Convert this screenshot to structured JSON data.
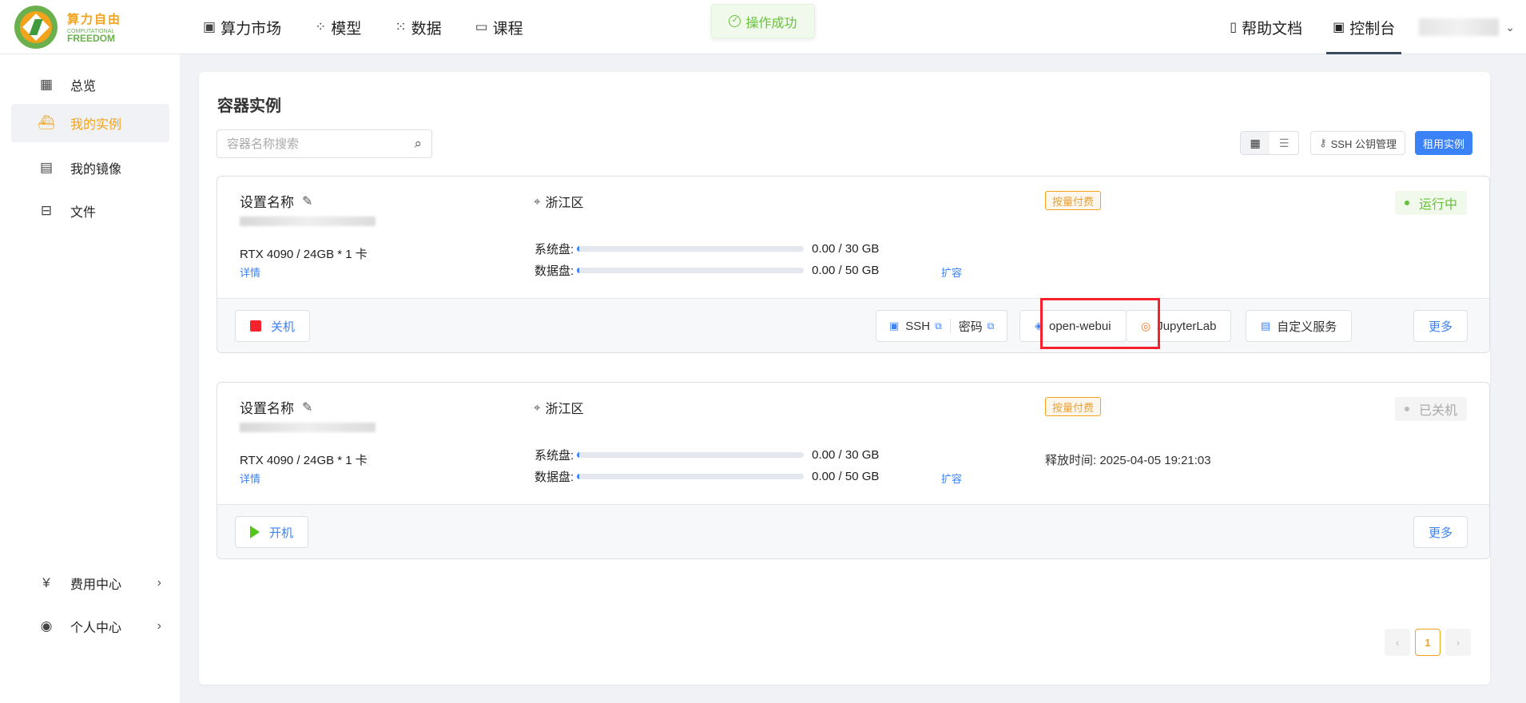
{
  "brand": {
    "cn": "算力自由",
    "en1": "COMPUTATIONAL",
    "en2": "FREEDOM"
  },
  "nav": [
    {
      "label": "算力市场",
      "icon": "chip-icon"
    },
    {
      "label": "模型",
      "icon": "model-icon"
    },
    {
      "label": "数据",
      "icon": "data-icon"
    },
    {
      "label": "课程",
      "icon": "course-icon"
    }
  ],
  "toast": {
    "text": "操作成功"
  },
  "right_nav": {
    "help": "帮助文档",
    "console": "控制台"
  },
  "sidebar": {
    "items": [
      {
        "label": "总览"
      },
      {
        "label": "我的实例"
      },
      {
        "label": "我的镜像"
      },
      {
        "label": "文件"
      }
    ],
    "bottom": [
      {
        "label": "费用中心"
      },
      {
        "label": "个人中心"
      }
    ]
  },
  "main": {
    "title": "容器实例",
    "search_placeholder": "容器名称搜索",
    "ssh_key_btn": "SSH 公钥管理",
    "rent_btn": "租用实例"
  },
  "instances": [
    {
      "name": "设置名称",
      "gpu": "RTX 4090 / 24GB  *  1 卡",
      "detail": "详情",
      "region": "浙江区",
      "billing": "按量付费",
      "status": "运行中",
      "sys_disk_label": "系统盘:",
      "sys_disk": "0.00 / 30 GB",
      "sys_disk_used": 0.0,
      "data_disk_label": "数据盘:",
      "data_disk": "0.00 / 50 GB",
      "data_disk_used": 0.0,
      "expand": "扩容",
      "power_btn": "关机",
      "ssh_label": "SSH",
      "pwd_label": "密码",
      "webui": "open-webui",
      "jupyter": "JupyterLab",
      "custom": "自定义服务",
      "more": "更多"
    },
    {
      "name": "设置名称",
      "gpu": "RTX 4090 / 24GB  *  1 卡",
      "detail": "详情",
      "region": "浙江区",
      "billing": "按量付费",
      "status": "已关机",
      "sys_disk_label": "系统盘:",
      "sys_disk": "0.00 / 30 GB",
      "sys_disk_used": 0.0,
      "data_disk_label": "数据盘:",
      "data_disk": "0.00 / 50 GB",
      "data_disk_used": 0.0,
      "expand": "扩容",
      "release": "释放时间: 2025-04-05 19:21:03",
      "power_btn": "开机",
      "more": "更多"
    }
  ],
  "pager": {
    "current": "1",
    "prev": "‹",
    "next": "›"
  },
  "colors": {
    "accent": "#f2a31c",
    "primary": "#3b82f6",
    "success": "#67c23a",
    "danger": "#f5222d"
  }
}
